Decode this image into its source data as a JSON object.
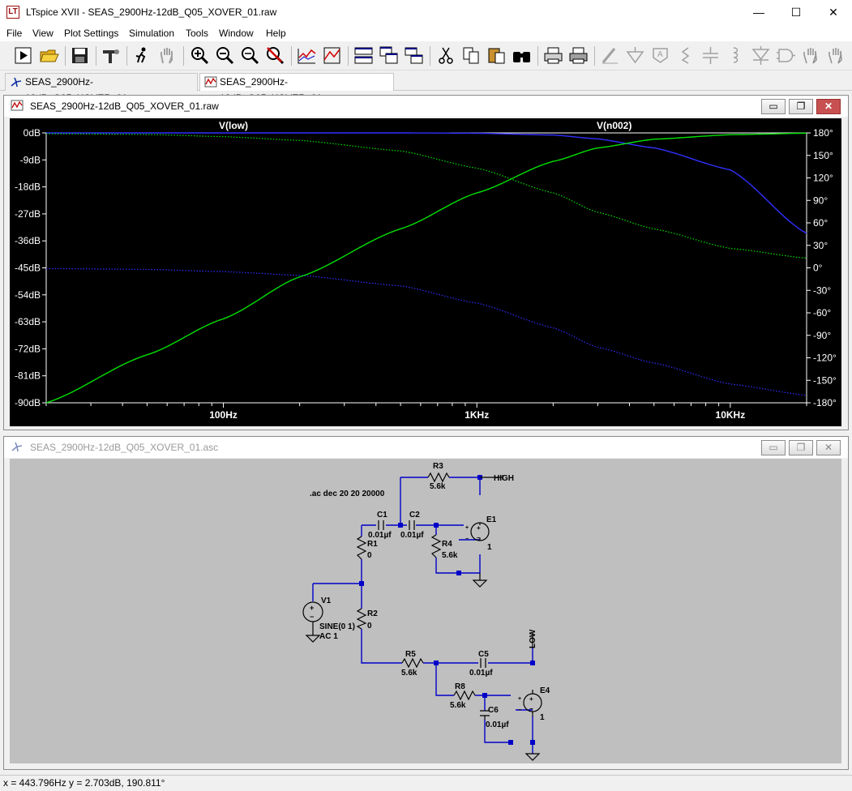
{
  "window": {
    "title": "LTspice XVII - SEAS_2900Hz-12dB_Q05_XOVER_01.raw",
    "controls": {
      "minimize": "—",
      "maximize": "☐",
      "close": "✕"
    }
  },
  "menu": [
    "File",
    "View",
    "Plot Settings",
    "Simulation",
    "Tools",
    "Window",
    "Help"
  ],
  "toolbar_icons": [
    "run-icon",
    "open-icon",
    "save-icon",
    "control-panel-icon",
    "run-arrow-icon",
    "pan-icon",
    "zoom-in-icon",
    "zoom-out-icon",
    "zoom-fit-icon",
    "zoom-cancel-icon",
    "autorange-icon",
    "zoom-area-icon",
    "tile-horizontal-icon",
    "cascade-icon",
    "tile-vertical-icon",
    "cut-icon",
    "copy-icon",
    "paste-icon",
    "find-icon",
    "print-setup-icon",
    "print-icon",
    "wire-icon",
    "ground-icon",
    "label-icon",
    "resistor-icon",
    "capacitor-icon",
    "inductor-icon",
    "diode-icon",
    "component-icon",
    "move-icon",
    "drag-icon"
  ],
  "tabs": [
    {
      "label": "SEAS_2900Hz-12dB_Q05_XOVER_01.asc",
      "active": false
    },
    {
      "label": "SEAS_2900Hz-12dB_Q05_XOVER_01.raw",
      "active": true
    }
  ],
  "plot_window": {
    "title": "SEAS_2900Hz-12dB_Q05_XOVER_01.raw",
    "buttons": {
      "minimize": "▭",
      "restore": "❐",
      "close": "✕"
    }
  },
  "schematic_window": {
    "title": "SEAS_2900Hz-12dB_Q05_XOVER_01.asc",
    "buttons": {
      "minimize": "▭",
      "restore": "❐",
      "close": "✕"
    }
  },
  "chart_data": {
    "type": "line",
    "x_scale": "log",
    "xlim": [
      20,
      20000
    ],
    "x_ticks": [
      {
        "value": 100,
        "label": "100Hz"
      },
      {
        "value": 1000,
        "label": "1KHz"
      },
      {
        "value": 10000,
        "label": "10KHz"
      }
    ],
    "ylim_left": [
      -90,
      0
    ],
    "y_ticks_left": [
      "0dB",
      "-9dB",
      "-18dB",
      "-27dB",
      "-36dB",
      "-45dB",
      "-54dB",
      "-63dB",
      "-72dB",
      "-81dB",
      "-90dB"
    ],
    "ylim_right": [
      -180,
      180
    ],
    "y_ticks_right": [
      "180°",
      "150°",
      "120°",
      "90°",
      "60°",
      "30°",
      "0°",
      "-30°",
      "-60°",
      "-90°",
      "-120°",
      "-150°",
      "-180°"
    ],
    "series": [
      {
        "name": "V(low)",
        "color": "#3030ff",
        "magnitude_db": {
          "x": [
            20,
            50,
            100,
            200,
            500,
            1000,
            2000,
            3000,
            5000,
            10000,
            20000
          ],
          "y": [
            0,
            0,
            0,
            0,
            0,
            -0.1,
            -0.7,
            -2,
            -5,
            -12.3,
            -33.5
          ]
        },
        "phase_deg": {
          "x": [
            20,
            50,
            100,
            200,
            500,
            1000,
            2000,
            3000,
            5000,
            10000,
            20000
          ],
          "y": [
            -1,
            -2,
            -5,
            -10,
            -24,
            -47,
            -80,
            -106,
            -127,
            -155,
            -170
          ]
        }
      },
      {
        "name": "V(n002)",
        "color": "#00e000",
        "magnitude_db": {
          "x": [
            20,
            50,
            100,
            200,
            500,
            1000,
            2000,
            3000,
            5000,
            10000,
            20000
          ],
          "y": [
            -90,
            -74,
            -62,
            -48,
            -32,
            -20,
            -9.5,
            -5,
            -2.1,
            -0.6,
            -0.1
          ]
        },
        "phase_deg": {
          "x": [
            20,
            50,
            100,
            200,
            500,
            1000,
            2000,
            3000,
            5000,
            10000,
            20000
          ],
          "y": [
            179,
            178,
            175,
            170,
            156,
            133,
            100,
            74,
            52,
            26,
            13
          ]
        }
      }
    ]
  },
  "schematic": {
    "directive": ".ac dec 20 20 20000",
    "components": {
      "R3": "5.6k",
      "C1": "0.01µf",
      "C2": "0.01µf",
      "E1": "1",
      "R1": "0",
      "R4": "5.6k",
      "V1_ref": "V1",
      "V1_value": "SINE(0 1)",
      "V1_ac": "AC 1",
      "R2": "0",
      "R5": "5.6k",
      "C5": "0.01µf",
      "R8": "5.6k",
      "C6": "0.01µf",
      "E4": "1"
    },
    "net_labels": {
      "high": "HIGH",
      "low": "LOW"
    }
  },
  "status": {
    "cursor": "x = 443.796Hz    y = 2.703dB, 190.811°"
  }
}
